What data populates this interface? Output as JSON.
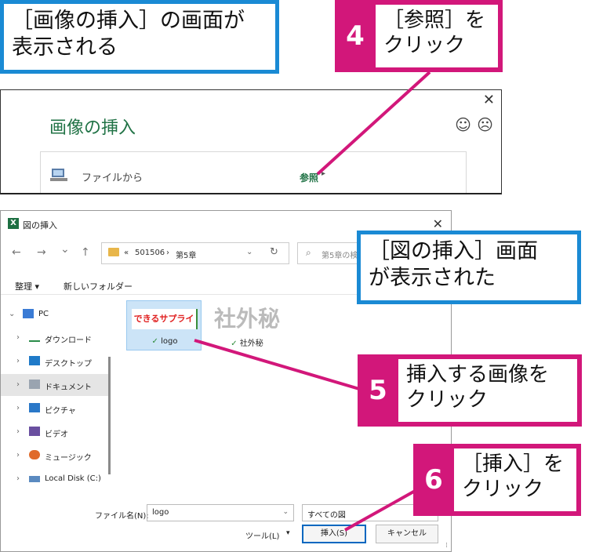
{
  "callouts": {
    "insert_dialog_shown": "［画像の挿入］の画面が\n表示される",
    "step4": {
      "num": "4",
      "text": "［参照］を\nクリック"
    },
    "figure_dialog_shown": "［図の挿入］画面\nが表示された",
    "step5": {
      "num": "5",
      "text": "挿入する画像を\nクリック"
    },
    "step6": {
      "num": "6",
      "text": "［挿入］を\nクリック"
    }
  },
  "insert_panel": {
    "title": "画像の挿入",
    "close": "✕",
    "smile": "☺",
    "frown": "☹",
    "from_file": "ファイルから",
    "browse": "参照",
    "arrow": "▸"
  },
  "file_dialog": {
    "app_icon": "X",
    "title": "図の挿入",
    "close": "✕",
    "nav": {
      "back": "←",
      "forward": "→",
      "recent": "⌄",
      "up": "↑"
    },
    "breadcrumb": [
      "«",
      "501506",
      "›",
      "第5章"
    ],
    "address_dropdown": "⌄",
    "refresh": "↻",
    "search_placeholder": "第5章の検索",
    "search_icon": "⌕",
    "organize": "整理 ▾",
    "new_folder": "新しいフォルダー",
    "tree": [
      {
        "label": "PC",
        "chev": "⌄",
        "icon": "pc-icon"
      },
      {
        "label": "ダウンロード",
        "chev": "›",
        "icon": "download-icon"
      },
      {
        "label": "デスクトップ",
        "chev": "›",
        "icon": "desktop-icon"
      },
      {
        "label": "ドキュメント",
        "chev": "›",
        "icon": "documents-icon"
      },
      {
        "label": "ピクチャ",
        "chev": "›",
        "icon": "pictures-icon"
      },
      {
        "label": "ビデオ",
        "chev": "›",
        "icon": "videos-icon"
      },
      {
        "label": "ミュージック",
        "chev": "›",
        "icon": "music-icon"
      },
      {
        "label": "Local Disk (C:)",
        "chev": "›",
        "icon": "disk-icon"
      }
    ],
    "files": [
      {
        "thumb_text": "できるサプライ",
        "name": "logo",
        "status": "✓"
      },
      {
        "thumb_text": "社外秘",
        "name": "社外秘",
        "status": "✓"
      }
    ],
    "filename_label": "ファイル名(N):",
    "filename_value": "logo",
    "filename_dd": "⌄",
    "filetype": "すべての図",
    "tools": "ツール(L)",
    "tools_dd": "▾",
    "insert_button": "挿入(S)",
    "cancel_button": "キャンセル",
    "grip": "⁞"
  },
  "colors": {
    "callout_blue": "#1a8ad4",
    "callout_pink": "#d2177a",
    "excel_green": "#217346"
  }
}
